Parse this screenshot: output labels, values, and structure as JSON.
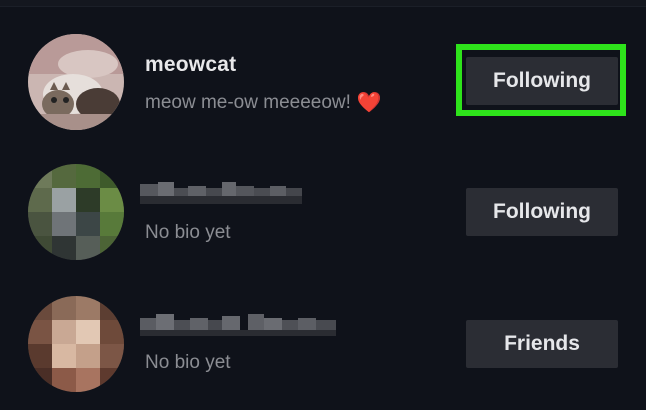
{
  "following_list": {
    "rows": [
      {
        "username": "meowcat",
        "bio": "meow me-ow meeeeow!",
        "bio_emoji": "❤️",
        "button_label": "Following",
        "highlighted": true
      },
      {
        "username_obscured": true,
        "bio": "No bio yet",
        "button_label": "Following"
      },
      {
        "username_obscured": true,
        "bio": "No bio yet",
        "button_label": "Friends"
      }
    ]
  },
  "colors": {
    "background": "#0f121a",
    "button_bg": "#2b2d34",
    "highlight": "#2ee31b"
  }
}
